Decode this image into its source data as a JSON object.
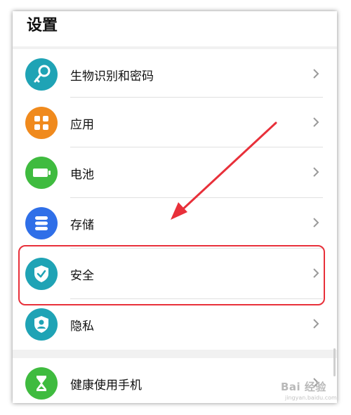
{
  "header": {
    "title": "设置"
  },
  "items": [
    {
      "label": "生物识别和密码",
      "icon": "key-icon",
      "color": "#1fa3b5"
    },
    {
      "label": "应用",
      "icon": "apps-grid-icon",
      "color": "#f08a1d"
    },
    {
      "label": "电池",
      "icon": "battery-icon",
      "color": "#3fbb3f"
    },
    {
      "label": "存储",
      "icon": "storage-icon",
      "color": "#2f6fe8"
    },
    {
      "label": "安全",
      "icon": "shield-check-icon",
      "color": "#1fa3b5"
    },
    {
      "label": "隐私",
      "icon": "privacy-icon",
      "color": "#1fa3b5"
    },
    {
      "label": "健康使用手机",
      "icon": "hourglass-icon",
      "color": "#3fbb3f"
    }
  ],
  "annotation": {
    "highlight_color": "#e8303a",
    "highlighted_item": "安全"
  },
  "watermark": {
    "text": "Bai 经验",
    "sub": "jingyan.baidu.com"
  }
}
